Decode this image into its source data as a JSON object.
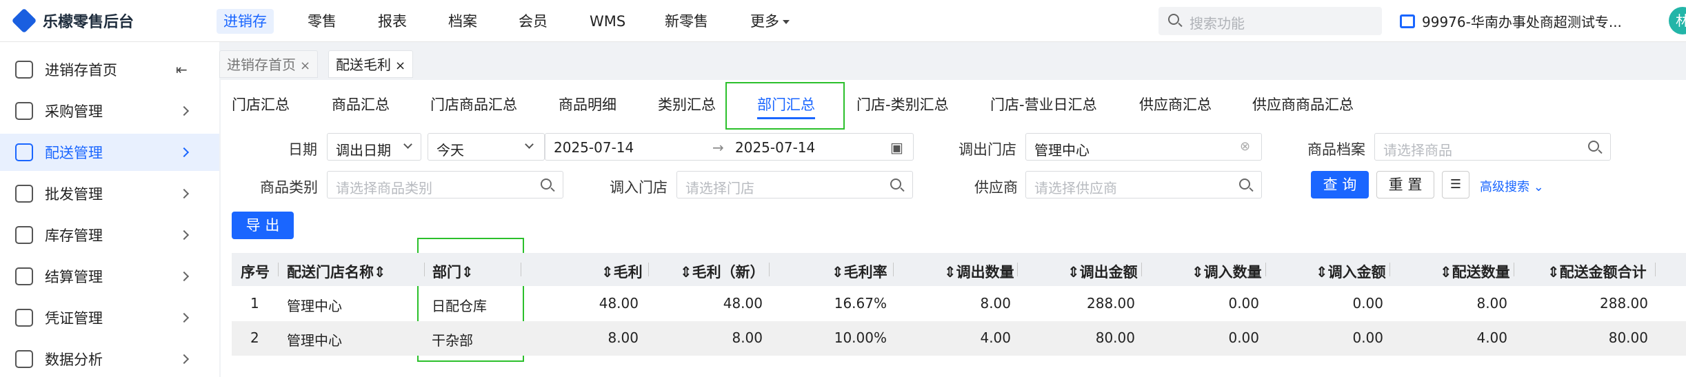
{
  "app": {
    "title": "乐檬零售后台"
  },
  "topnav": {
    "items": [
      {
        "label": "进销存",
        "active": true
      },
      {
        "label": "零售"
      },
      {
        "label": "报表"
      },
      {
        "label": "档案"
      },
      {
        "label": "会员"
      },
      {
        "label": "WMS"
      },
      {
        "label": "新零售"
      },
      {
        "label": "更多"
      }
    ],
    "search_placeholder": "搜索功能",
    "store": "99976-华南办事处商超测试专...",
    "avatar_text": "林"
  },
  "sidebar": {
    "items": [
      {
        "label": "进销存首页",
        "icon": "home-icon"
      },
      {
        "label": "采购管理",
        "icon": "cart-icon"
      },
      {
        "label": "配送管理",
        "icon": "delivery-icon",
        "active": true
      },
      {
        "label": "批发管理",
        "icon": "wholesale-icon"
      },
      {
        "label": "库存管理",
        "icon": "inventory-icon"
      },
      {
        "label": "结算管理",
        "icon": "settlement-icon"
      },
      {
        "label": "凭证管理",
        "icon": "voucher-icon"
      },
      {
        "label": "数据分析",
        "icon": "chart-icon"
      }
    ]
  },
  "page_tabs": [
    {
      "label": "进销存首页"
    },
    {
      "label": "配送毛利",
      "active": true
    }
  ],
  "report_tabs": [
    {
      "label": "门店汇总"
    },
    {
      "label": "商品汇总"
    },
    {
      "label": "门店商品汇总"
    },
    {
      "label": "商品明细"
    },
    {
      "label": "类别汇总"
    },
    {
      "label": "部门汇总",
      "active": true
    },
    {
      "label": "门店-类别汇总"
    },
    {
      "label": "门店-营业日汇总"
    },
    {
      "label": "供应商汇总"
    },
    {
      "label": "供应商商品汇总"
    }
  ],
  "filters": {
    "date_label": "日期",
    "date_type": "调出日期",
    "date_range_preset": "今天",
    "start_date": "2025-07-14",
    "range_arrow": "→",
    "end_date": "2025-07-14",
    "out_store_label": "调出门店",
    "out_store_value": "管理中心",
    "product_label": "商品档案",
    "product_placeholder": "请选择商品",
    "category_label": "商品类别",
    "category_placeholder": "请选择商品类别",
    "in_store_label": "调入门店",
    "in_store_placeholder": "请选择门店",
    "supplier_label": "供应商",
    "supplier_placeholder": "请选择供应商",
    "query_button": "查 询",
    "reset_button": "重 置",
    "advanced_search": "高级搜索"
  },
  "export_button": "导 出",
  "table": {
    "headers": [
      "序号",
      "配送门店名称",
      "部门",
      "毛利",
      "毛利（新）",
      "毛利率",
      "调出数量",
      "调出金额",
      "调入数量",
      "调入金额",
      "配送数量",
      "配送金额合计"
    ],
    "rows": [
      [
        "1",
        "管理中心",
        "日配仓库",
        "48.00",
        "48.00",
        "16.67%",
        "8.00",
        "288.00",
        "0.00",
        "0.00",
        "8.00",
        "288.00"
      ],
      [
        "2",
        "管理中心",
        "干杂部",
        "8.00",
        "8.00",
        "10.00%",
        "4.00",
        "80.00",
        "0.00",
        "0.00",
        "4.00",
        "80.00"
      ]
    ]
  },
  "colors": {
    "accent": "#1a66ff",
    "highlight": "#2bc02b"
  }
}
